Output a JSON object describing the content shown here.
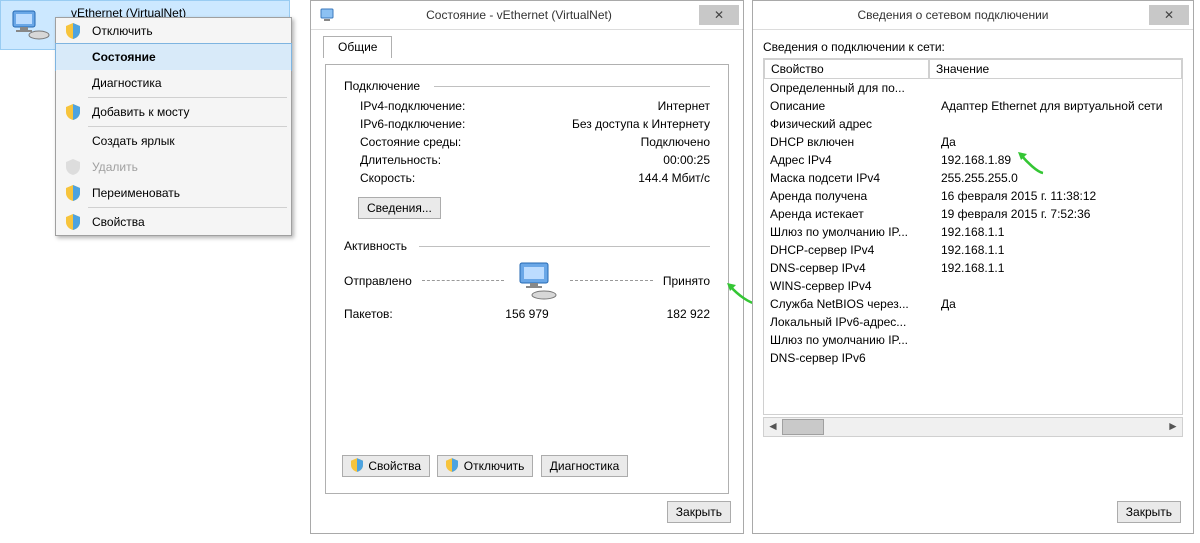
{
  "adapter_name": "vEthernet (VirtualNet)",
  "context_menu": {
    "disable": "Отключить",
    "status": "Состояние",
    "diagnose": "Диагностика",
    "bridge": "Добавить к мосту",
    "shortcut": "Создать ярлык",
    "delete": "Удалить",
    "rename": "Переименовать",
    "properties": "Свойства"
  },
  "status_window": {
    "title": "Состояние - vEthernet (VirtualNet)",
    "tab_general": "Общие",
    "group_connection": "Подключение",
    "ipv4_label": "IPv4-подключение:",
    "ipv4_value": "Интернет",
    "ipv6_label": "IPv6-подключение:",
    "ipv6_value": "Без доступа к Интернету",
    "media_label": "Состояние среды:",
    "media_value": "Подключено",
    "duration_label": "Длительность:",
    "duration_value": "00:00:25",
    "speed_label": "Скорость:",
    "speed_value": "144.4 Мбит/с",
    "details_button": "Сведения...",
    "group_activity": "Активность",
    "sent_label": "Отправлено",
    "received_label": "Принято",
    "packets_label": "Пакетов:",
    "packets_sent": "156 979",
    "packets_received": "182 922",
    "btn_properties": "Свойства",
    "btn_disable": "Отключить",
    "btn_diagnose": "Диагностика",
    "btn_close": "Закрыть"
  },
  "details_window": {
    "title": "Сведения о сетевом подключении",
    "caption": "Сведения о подключении к сети:",
    "col_property": "Свойство",
    "col_value": "Значение",
    "rows": [
      {
        "k": "Определенный для по...",
        "v": ""
      },
      {
        "k": "Описание",
        "v": "Адаптер Ethernet для виртуальной сети"
      },
      {
        "k": "Физический адрес",
        "v": ""
      },
      {
        "k": "DHCP включен",
        "v": "Да"
      },
      {
        "k": "Адрес IPv4",
        "v": "192.168.1.89"
      },
      {
        "k": "Маска подсети IPv4",
        "v": "255.255.255.0"
      },
      {
        "k": "Аренда получена",
        "v": "16 февраля 2015 г. 11:38:12"
      },
      {
        "k": "Аренда истекает",
        "v": "19 февраля 2015 г. 7:52:36"
      },
      {
        "k": "Шлюз по умолчанию IP...",
        "v": "192.168.1.1"
      },
      {
        "k": "DHCP-сервер IPv4",
        "v": "192.168.1.1"
      },
      {
        "k": "DNS-сервер IPv4",
        "v": "192.168.1.1"
      },
      {
        "k": "WINS-сервер IPv4",
        "v": ""
      },
      {
        "k": "Служба NetBIOS через...",
        "v": "Да"
      },
      {
        "k": "Локальный IPv6-адрес...",
        "v": ""
      },
      {
        "k": "Шлюз по умолчанию IP...",
        "v": ""
      },
      {
        "k": "DNS-сервер IPv6",
        "v": ""
      }
    ],
    "btn_close": "Закрыть"
  }
}
